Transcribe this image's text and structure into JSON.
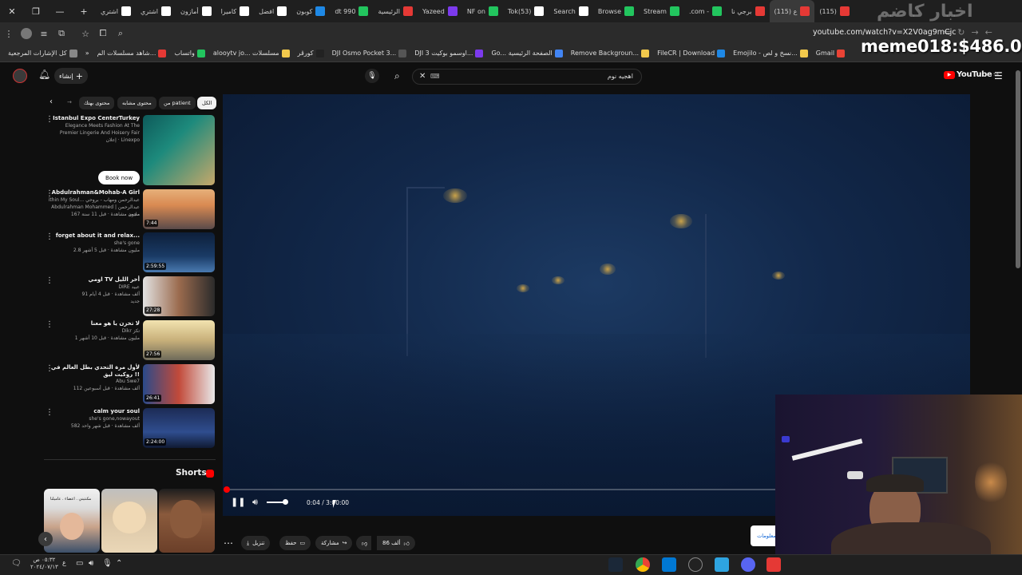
{
  "browser": {
    "tabs": [
      {
        "label": "اشتري",
        "color": "#ffffff"
      },
      {
        "label": "اشتري",
        "color": "#ffffff"
      },
      {
        "label": "أمازون",
        "color": "#ffffff"
      },
      {
        "label": "كاميرا",
        "color": "#ffffff"
      },
      {
        "label": "افضل",
        "color": "#ffffff"
      },
      {
        "label": "كوبون",
        "color": "#1e88e5"
      },
      {
        "label": "dt 990",
        "color": "#22c55e"
      },
      {
        "label": "الرئيسية",
        "color": "#e53935"
      },
      {
        "label": "Yazeed",
        "color": "#7c3aed"
      },
      {
        "label": "NF on",
        "color": "#22c55e"
      },
      {
        "label": "Tok(53)",
        "color": "#ffffff"
      },
      {
        "label": "Search",
        "color": "#ffffff"
      },
      {
        "label": "Browse",
        "color": "#22c55e"
      },
      {
        "label": "Stream",
        "color": "#22c55e"
      },
      {
        "label": ".com -",
        "color": "#22c55e"
      },
      {
        "label": "برجي نا",
        "color": "#e53935"
      },
      {
        "label": "(115) ع",
        "color": "#e53935"
      },
      {
        "label": "(115)",
        "color": "#e53935"
      }
    ],
    "url": "youtube.com/watch?v=X2V0ag9mCjc",
    "stream_overlay": "meme018:$486.00",
    "bookmarks": [
      {
        "label": "كل الإشارات المرجعية",
        "color": "#888888"
      },
      {
        "label": "شاهد مسلسلات الم...",
        "color": "#e53935"
      },
      {
        "label": "واتساب",
        "color": "#22c55e"
      },
      {
        "label": "alooytv jo... مسلسلات",
        "color": "#f2c94c"
      },
      {
        "label": "كورڤر",
        "color": "#222222"
      },
      {
        "label": "DJI Osmo Pocket 3...",
        "color": "#555555"
      },
      {
        "label": "DJI اوسمو بوكيت 3...",
        "color": "#7c3aed"
      },
      {
        "label": "Go... الصفحة الرئيسية",
        "color": "#4285f4"
      },
      {
        "label": "Remove Backgroun...",
        "color": "#f2c94c"
      },
      {
        "label": "FileCR | Download",
        "color": "#1e88e5"
      },
      {
        "label": "Emojilo - نسخ و لص...",
        "color": "#f2c94c"
      },
      {
        "label": "Gmail",
        "color": "#ea4335"
      }
    ]
  },
  "youtube": {
    "logo": "YouTube",
    "logo_sup": "SA",
    "create_label": "إنشاء",
    "search_value": "اهجيه نوم",
    "chips": [
      "الكل",
      "من patient",
      "محتوى مشابه",
      "محتوى بهتك"
    ],
    "related": [
      {
        "title": "Istanbul Expo CenterTurkey",
        "line2": "Elegance Meets Fashion At The",
        "line3": "Premier Lingerie And Hoisery Fair",
        "meta": "إعلان · Linexpo",
        "duration": "",
        "action": "Book now"
      },
      {
        "title": "Abdulrahman&Mohab-A Girl",
        "line2": "ithin My Soul... عبدالرحمن ومهاب - بروحي",
        "line3": "Abdulrahman Mohammed | عبدالرحمن محمد",
        "meta": "167 مليون مشاهدة · قبل 11 سنة",
        "duration": "7:44"
      },
      {
        "title": "forget about it and relax...",
        "line2": "she's gone",
        "line3": "",
        "meta": "2.8 مليون مشاهدة · قبل 5 أشهر",
        "duration": "2:59:55"
      },
      {
        "title": "اومي TV أخر الليل",
        "line2": "DIRE عبيد",
        "line3": "91 ألف مشاهدة · قبل 4 أيام",
        "meta": "جديد",
        "duration": "27:28"
      },
      {
        "title": "لا تخزن يا هو معنا",
        "line2": "Dikr تكز",
        "line3": "",
        "meta": "1 مليون مشاهدة · قبل 10 أشهر",
        "duration": "27:56"
      },
      {
        "title": "لأول مرة التحدي بطل العالم في روكيت ليق !!",
        "line2": "Abu Swe7",
        "line3": "",
        "meta": "112 ألف مشاهدة · قبل أسبوعين",
        "duration": "26:41"
      },
      {
        "title": "calm your soul",
        "line2": "she's gone,nowayout",
        "line3": "",
        "meta": "582 ألف مشاهدة · قبل شهر واحد",
        "duration": "2:24:00"
      }
    ],
    "shorts_title": "Shorts",
    "player": {
      "time": "0:04 / 3:00:00",
      "progress": 0.0004,
      "volume": 1.0
    },
    "actions": {
      "like_count": "86 ألف",
      "share": "مشاركة",
      "save": "حفظ",
      "download": "تنزيل",
      "info": "معلومات"
    }
  },
  "taskbar": {
    "time": "٠٥:٣٢ ص",
    "date": "٢٠٢٤/٠٧/١٣",
    "lang": "ع"
  }
}
